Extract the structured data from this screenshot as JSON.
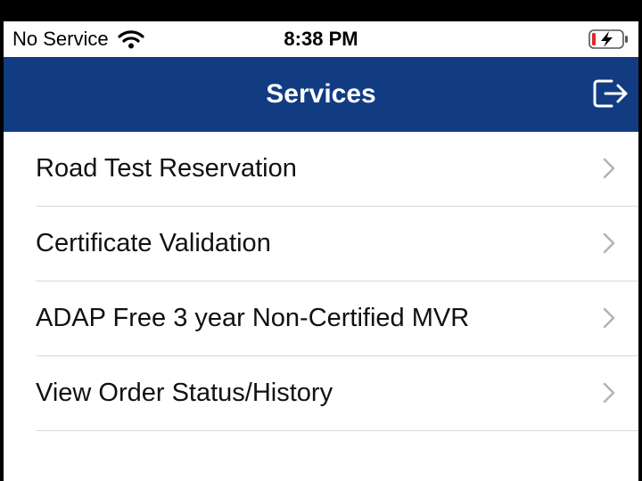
{
  "status_bar": {
    "carrier": "No Service",
    "time": "8:38 PM"
  },
  "nav": {
    "title": "Services",
    "logout_icon": "logout-icon",
    "color": "#123c82"
  },
  "services": {
    "items": [
      {
        "label": "Road Test Reservation"
      },
      {
        "label": "Certificate Validation"
      },
      {
        "label": "ADAP Free 3 year Non-Certified MVR"
      },
      {
        "label": "View Order Status/History"
      }
    ]
  }
}
